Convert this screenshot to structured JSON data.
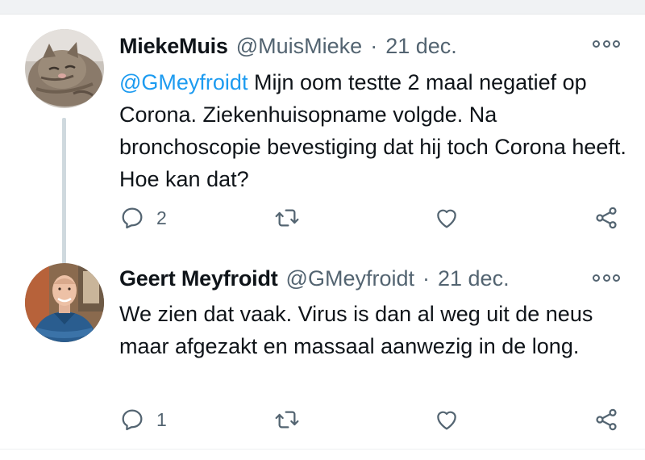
{
  "tweets": [
    {
      "name": "MiekeMuis",
      "handle": "@MuisMieke",
      "separator": "·",
      "date": "21 dec.",
      "mention": "@GMeyfroidt",
      "text": " Mijn oom testte 2 maal negatief op Corona. Ziekenhuisopname volgde. Na bronchoscopie bevestiging dat hij toch Corona heeft. Hoe kan dat?",
      "reply_count": "2",
      "avatar": "cat-photo"
    },
    {
      "name": "Geert Meyfroidt",
      "handle": "@GMeyfroidt",
      "separator": "·",
      "date": "21 dec.",
      "text": "We zien dat vaak. Virus is dan al weg uit de neus maar afgezakt en massaal aanwezig in de long.",
      "reply_count": "1",
      "avatar": "man-in-scrubs-photo"
    }
  ],
  "icons": [
    "reply-icon",
    "retweet-icon",
    "like-icon",
    "share-icon",
    "more-options-icon"
  ],
  "colors": {
    "accent": "#1d9bf0",
    "text": "#0f1419",
    "secondary": "#536471",
    "thread_line": "#cfd9de"
  }
}
